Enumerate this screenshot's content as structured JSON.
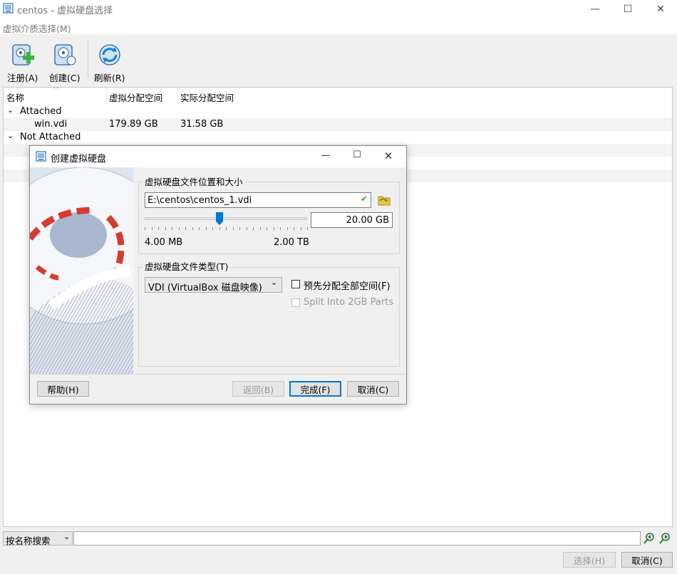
{
  "window": {
    "title": "centos - 虚拟硬盘选择",
    "minimize": "—",
    "maximize": "☐",
    "close": "✕"
  },
  "menu": {
    "media": "虚拟介质选择(M)"
  },
  "toolbar": {
    "add": "注册(A)",
    "create": "创建(C)",
    "refresh": "刷新(R)"
  },
  "tree": {
    "columns": [
      "名称",
      "虚拟分配空间",
      "实际分配空间"
    ],
    "groups": [
      {
        "label": "Attached",
        "items": [
          {
            "name": "win.vdi",
            "virtual": "179.89 GB",
            "actual": "31.58 GB"
          }
        ]
      },
      {
        "label": "Not Attached",
        "items": []
      }
    ]
  },
  "search": {
    "mode": "按名称搜索",
    "value": ""
  },
  "bottom": {
    "choose": "选择(H)",
    "cancel": "取消(C)"
  },
  "dialog": {
    "title": "创建虚拟硬盘",
    "location_group": "虚拟硬盘文件位置和大小",
    "path": "E:\\centos\\centos_1.vdi",
    "size": "20.00 GB",
    "size_level": 0.46,
    "min_label": "4.00 MB",
    "max_label": "2.00 TB",
    "type_group": "虚拟硬盘文件类型(T)",
    "type_value": "VDI (VirtualBox 磁盘映像)",
    "prealloc": "预先分配全部空间(F)",
    "split": "Split Into 2GB Parts",
    "help": "帮助(H)",
    "back": "返回(B)",
    "finish": "完成(F)",
    "cancel": "取消(C)",
    "accent": "#0078d7"
  }
}
